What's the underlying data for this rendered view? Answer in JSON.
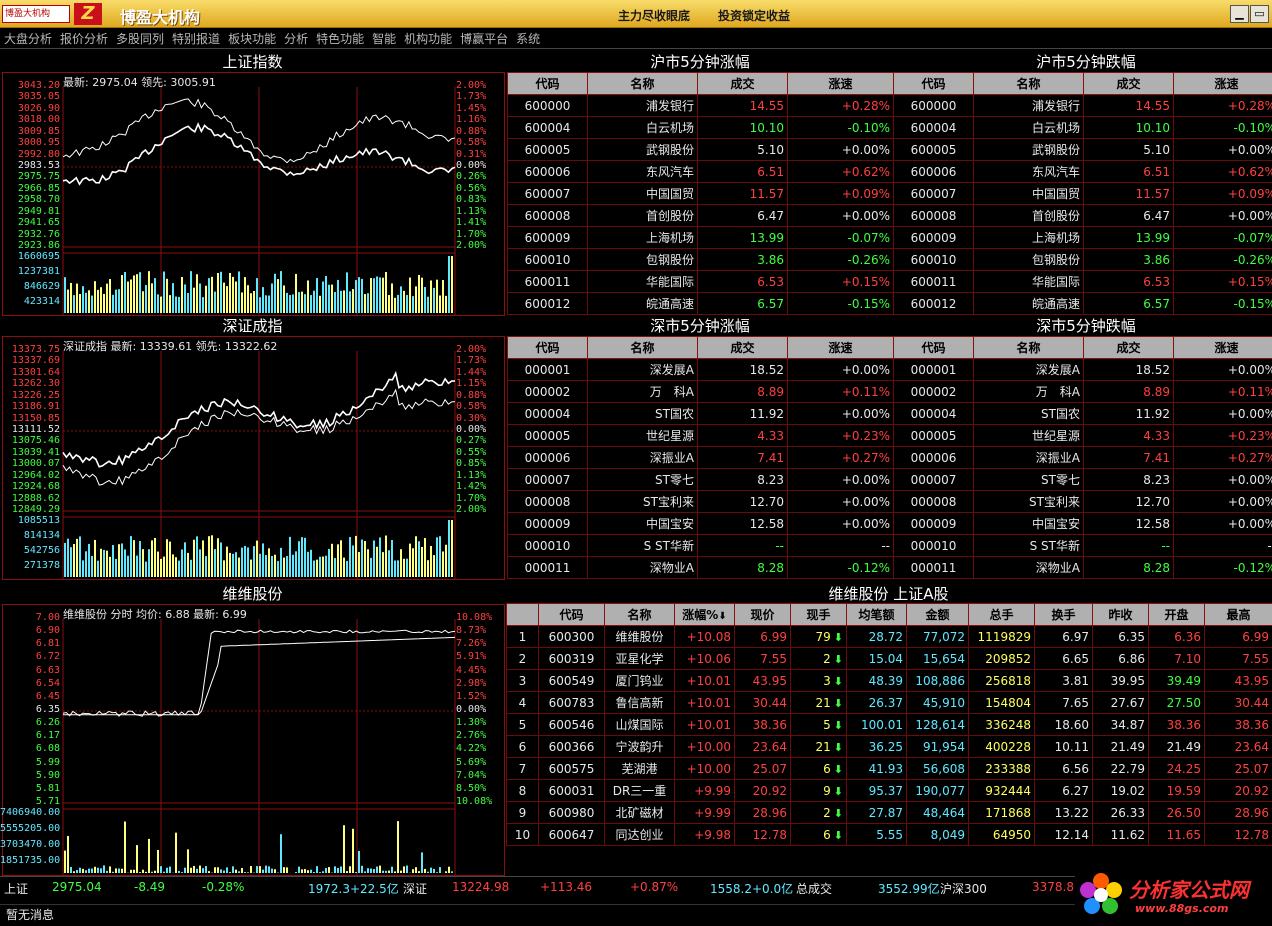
{
  "app": {
    "logo_text": "博盈大机构",
    "logo_mark": "Z",
    "title": "博盈大机构",
    "slogan1": "主力尽收眼底",
    "slogan2": "投资锁定收益",
    "min": "▁",
    "max": "▭"
  },
  "menu": [
    "大盘分析",
    "报价分析",
    "多股同列",
    "特别报道",
    "板块功能",
    "分析",
    "特色功能",
    "智能",
    "机构功能",
    "博赢平台",
    "系统"
  ],
  "charts": [
    {
      "title": "上证指数",
      "info": "最新: 2975.04 领先: 3005.91",
      "left_labels": [
        "3043.20",
        "3035.05",
        "3026.90",
        "3018.00",
        "3009.85",
        "3000.95",
        "2992.80",
        "2983.53",
        "2975.75",
        "2966.85",
        "2958.70",
        "2949.81",
        "2941.65",
        "2932.76",
        "2923.86"
      ],
      "right_labels": [
        "2.00%",
        "1.73%",
        "1.45%",
        "1.16%",
        "0.88%",
        "0.58%",
        "0.31%",
        "0.00%",
        "0.26%",
        "0.56%",
        "0.83%",
        "1.13%",
        "1.41%",
        "1.70%",
        "2.00%"
      ],
      "vol_labels": [
        "1660695",
        "1237381",
        "846629",
        "423314"
      ]
    },
    {
      "title": "深证成指",
      "info": "深证成指 最新: 13339.61 领先: 13322.62",
      "left_labels": [
        "13373.75",
        "13337.69",
        "13301.64",
        "13262.30",
        "13226.25",
        "13186.91",
        "13150.85",
        "13111.52",
        "13075.46",
        "13039.41",
        "13000.07",
        "12964.02",
        "12924.68",
        "12888.62",
        "12849.29"
      ],
      "right_labels": [
        "2.00%",
        "1.73%",
        "1.44%",
        "1.15%",
        "0.88%",
        "0.58%",
        "0.30%",
        "0.00%",
        "0.27%",
        "0.55%",
        "0.85%",
        "1.13%",
        "1.42%",
        "1.70%",
        "2.00%"
      ],
      "vol_labels": [
        "1085513",
        "814134",
        "542756",
        "271378"
      ]
    },
    {
      "title": "维维股份",
      "info": "维维股份 分时 均价: 6.88 最新: 6.99",
      "left_labels": [
        "7.00",
        "6.90",
        "6.81",
        "6.72",
        "6.63",
        "6.54",
        "6.45",
        "6.35",
        "6.26",
        "6.17",
        "6.08",
        "5.99",
        "5.90",
        "5.81",
        "5.71"
      ],
      "right_labels": [
        "10.08%",
        "8.73%",
        "7.26%",
        "5.91%",
        "4.45%",
        "2.98%",
        "1.52%",
        "0.00%",
        "1.30%",
        "2.76%",
        "4.22%",
        "5.69%",
        "7.04%",
        "8.50%",
        "10.08%"
      ],
      "vol_labels": [
        "7406940.00",
        "5555205.00",
        "3703470.00",
        "1851735.00"
      ]
    }
  ],
  "tables": {
    "headers": [
      "代码",
      "名称",
      "成交",
      "涨速"
    ],
    "sh_up": {
      "title": "沪市5分钟涨幅",
      "rows": [
        [
          "600000",
          "浦发银行",
          "14.55",
          "+0.28%"
        ],
        [
          "600004",
          "白云机场",
          "10.10",
          "-0.10%"
        ],
        [
          "600005",
          "武钢股份",
          "5.10",
          "+0.00%"
        ],
        [
          "600006",
          "东风汽车",
          "6.51",
          "+0.62%"
        ],
        [
          "600007",
          "中国国贸",
          "11.57",
          "+0.09%"
        ],
        [
          "600008",
          "首创股份",
          "6.47",
          "+0.00%"
        ],
        [
          "600009",
          "上海机场",
          "13.99",
          "-0.07%"
        ],
        [
          "600010",
          "包钢股份",
          "3.86",
          "-0.26%"
        ],
        [
          "600011",
          "华能国际",
          "6.53",
          "+0.15%"
        ],
        [
          "600012",
          "皖通高速",
          "6.57",
          "-0.15%"
        ]
      ]
    },
    "sh_down": {
      "title": "沪市5分钟跌幅",
      "rows": [
        [
          "600000",
          "浦发银行",
          "14.55",
          "+0.28%"
        ],
        [
          "600004",
          "白云机场",
          "10.10",
          "-0.10%"
        ],
        [
          "600005",
          "武钢股份",
          "5.10",
          "+0.00%"
        ],
        [
          "600006",
          "东风汽车",
          "6.51",
          "+0.62%"
        ],
        [
          "600007",
          "中国国贸",
          "11.57",
          "+0.09%"
        ],
        [
          "600008",
          "首创股份",
          "6.47",
          "+0.00%"
        ],
        [
          "600009",
          "上海机场",
          "13.99",
          "-0.07%"
        ],
        [
          "600010",
          "包钢股份",
          "3.86",
          "-0.26%"
        ],
        [
          "600011",
          "华能国际",
          "6.53",
          "+0.15%"
        ],
        [
          "600012",
          "皖通高速",
          "6.57",
          "-0.15%"
        ]
      ]
    },
    "sz_up": {
      "title": "深市5分钟涨幅",
      "rows": [
        [
          "000001",
          "深发展A",
          "18.52",
          "+0.00%"
        ],
        [
          "000002",
          "万　科A",
          "8.89",
          "+0.11%"
        ],
        [
          "000004",
          "ST国农",
          "11.92",
          "+0.00%"
        ],
        [
          "000005",
          "世纪星源",
          "4.33",
          "+0.23%"
        ],
        [
          "000006",
          "深振业A",
          "7.41",
          "+0.27%"
        ],
        [
          "000007",
          "ST零七",
          "8.23",
          "+0.00%"
        ],
        [
          "000008",
          "ST宝利来",
          "12.70",
          "+0.00%"
        ],
        [
          "000009",
          "中国宝安",
          "12.58",
          "+0.00%"
        ],
        [
          "000010",
          "S ST华新",
          "--",
          "--"
        ],
        [
          "000011",
          "深物业A",
          "8.28",
          "-0.12%"
        ]
      ]
    },
    "sz_down": {
      "title": "深市5分钟跌幅",
      "rows": [
        [
          "000001",
          "深发展A",
          "18.52",
          "+0.00%"
        ],
        [
          "000002",
          "万　科A",
          "8.89",
          "+0.11%"
        ],
        [
          "000004",
          "ST国农",
          "11.92",
          "+0.00%"
        ],
        [
          "000005",
          "世纪星源",
          "4.33",
          "+0.23%"
        ],
        [
          "000006",
          "深振业A",
          "7.41",
          "+0.27%"
        ],
        [
          "000007",
          "ST零七",
          "8.23",
          "+0.00%"
        ],
        [
          "000008",
          "ST宝利来",
          "12.70",
          "+0.00%"
        ],
        [
          "000009",
          "中国宝安",
          "12.58",
          "+0.00%"
        ],
        [
          "000010",
          "S ST华新",
          "--",
          "--"
        ],
        [
          "000011",
          "深物业A",
          "8.28",
          "-0.12%"
        ]
      ]
    }
  },
  "quotes": {
    "title": "维维股份  上证A股",
    "headers": [
      "",
      "代码",
      "名称",
      "涨幅%",
      "现价",
      "现手",
      "均笔额",
      "金额",
      "总手",
      "换手",
      "昨收",
      "开盘",
      "最高"
    ],
    "sort_mark": "⬇",
    "rows": [
      [
        "1",
        "600300",
        "维维股份",
        "+10.08",
        "6.99",
        "79",
        "28.72",
        "77,072",
        "1119829",
        "6.97",
        "6.35",
        "6.36",
        "6.99"
      ],
      [
        "2",
        "600319",
        "亚星化学",
        "+10.06",
        "7.55",
        "2",
        "15.04",
        "15,654",
        "209852",
        "6.65",
        "6.86",
        "7.10",
        "7.55"
      ],
      [
        "3",
        "600549",
        "厦门钨业",
        "+10.01",
        "43.95",
        "3",
        "48.39",
        "108,886",
        "256818",
        "3.81",
        "39.95",
        "39.49",
        "43.95"
      ],
      [
        "4",
        "600783",
        "鲁信高新",
        "+10.01",
        "30.44",
        "21",
        "26.37",
        "45,910",
        "154804",
        "7.65",
        "27.67",
        "27.50",
        "30.44"
      ],
      [
        "5",
        "600546",
        "山煤国际",
        "+10.01",
        "38.36",
        "5",
        "100.01",
        "128,614",
        "336248",
        "18.60",
        "34.87",
        "38.36",
        "38.36"
      ],
      [
        "6",
        "600366",
        "宁波韵升",
        "+10.00",
        "23.64",
        "21",
        "36.25",
        "91,954",
        "400228",
        "10.11",
        "21.49",
        "21.49",
        "23.64"
      ],
      [
        "7",
        "600575",
        "芜湖港",
        "+10.00",
        "25.07",
        "6",
        "41.93",
        "56,608",
        "233388",
        "6.56",
        "22.79",
        "24.25",
        "25.07"
      ],
      [
        "8",
        "600031",
        "DR三一重",
        "+9.99",
        "20.92",
        "9",
        "95.37",
        "190,077",
        "932444",
        "6.27",
        "19.02",
        "19.59",
        "20.92"
      ],
      [
        "9",
        "600980",
        "北矿磁材",
        "+9.99",
        "28.96",
        "2",
        "27.87",
        "48,464",
        "171868",
        "13.22",
        "26.33",
        "26.50",
        "28.96"
      ],
      [
        "10",
        "600647",
        "同达创业",
        "+9.98",
        "12.78",
        "6",
        "5.55",
        "8,049",
        "64950",
        "12.14",
        "11.62",
        "11.65",
        "12.78"
      ]
    ]
  },
  "status": {
    "sh_name": "上证",
    "sh_val": "2975.04",
    "sh_chg": "-8.49",
    "sh_pct": "-0.28%",
    "sh_amt": "1972.3+22.5亿",
    "sz_name": "深证",
    "sz_val": "13224.98",
    "sz_chg": "+113.46",
    "sz_pct": "+0.87%",
    "sz_amt": "1558.2+0.0亿",
    "tot_label": "总成交",
    "tot_val": "3552.99亿",
    "hs_name": "沪深300",
    "hs_val": "3378.8"
  },
  "message": "暂无消息",
  "watermark": {
    "name": "分析家公式网",
    "url": "www.88gs.com"
  },
  "colors": {
    "up": "#ff4040",
    "down": "#40ff40",
    "flat": "#e8e8e8",
    "grid": "#8a1010"
  }
}
